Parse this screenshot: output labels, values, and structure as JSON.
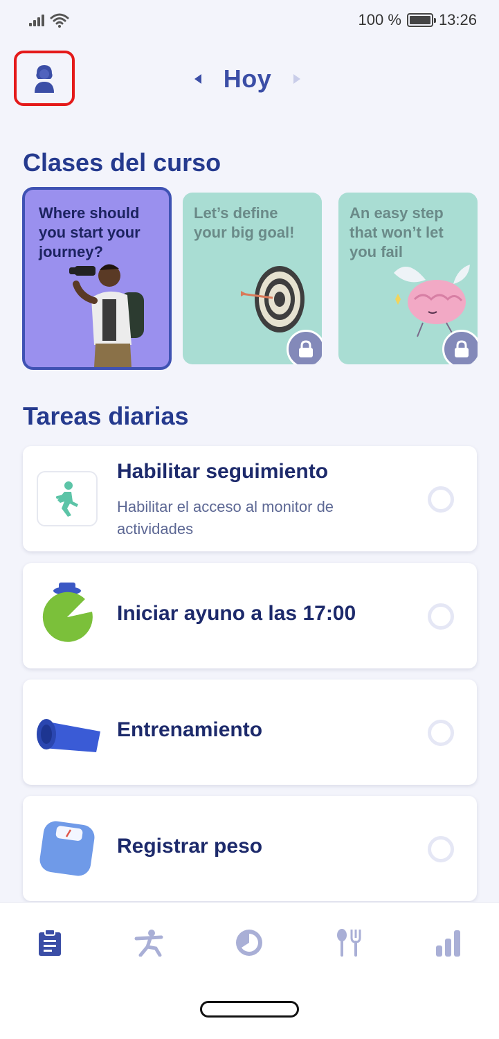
{
  "status_bar": {
    "battery": "100 %",
    "time": "13:26"
  },
  "header": {
    "day_label": "Hoy"
  },
  "sections": {
    "course_title": "Clases del curso",
    "tasks_title": "Tareas diarias"
  },
  "course_cards": [
    {
      "text": "Where should you start your journey?",
      "locked": false
    },
    {
      "text": "Let’s define your big goal!",
      "locked": true
    },
    {
      "text": "An easy step that won’t let you fail",
      "locked": true
    }
  ],
  "tasks": [
    {
      "title": "Habilitar seguimiento",
      "subtitle": "Habilitar el acceso al monitor de actividades",
      "icon": "running-person-icon"
    },
    {
      "title": "Iniciar ayuno a las 17:00",
      "icon": "timer-icon"
    },
    {
      "title": "Entrenamiento",
      "icon": "yoga-mat-icon"
    },
    {
      "title": "Registrar peso",
      "icon": "scale-icon"
    }
  ],
  "bottom_nav": [
    "clipboard-icon",
    "exercise-icon",
    "fasting-icon",
    "food-icon",
    "stats-icon"
  ],
  "colors": {
    "accent": "#3b4ea6",
    "highlight_border": "#e41a1a",
    "card_active": "#9a90ee",
    "card_locked": "#a9ddd3"
  }
}
